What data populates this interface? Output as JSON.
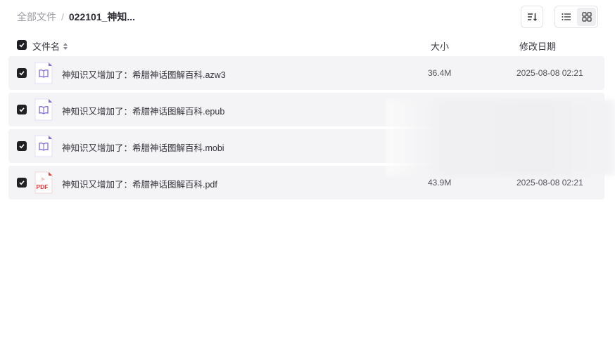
{
  "breadcrumb": {
    "root": "全部文件",
    "separator": "/",
    "current": "022101_神知..."
  },
  "toolbar": {
    "sort_icon": "sort-icon",
    "list_view_icon": "list-view-icon",
    "grid_view_icon": "grid-view-icon"
  },
  "table": {
    "columns": {
      "name": "文件名",
      "size": "大小",
      "date": "修改日期"
    },
    "rows": [
      {
        "name": "神知识又增加了：希腊神话图解百科.azw3",
        "size": "36.4M",
        "date": "2025-08-08 02:21",
        "type": "ebook",
        "checked": true
      },
      {
        "name": "神知识又增加了：希腊神话图解百科.epub",
        "size": "",
        "date": "",
        "type": "ebook",
        "checked": true
      },
      {
        "name": "神知识又增加了：希腊神话图解百科.mobi",
        "size": "",
        "date": "",
        "type": "ebook",
        "checked": true
      },
      {
        "name": "神知识又增加了：希腊神话图解百科.pdf",
        "size": "43.9M",
        "date": "2025-08-08 02:21",
        "type": "pdf",
        "checked": true
      }
    ]
  },
  "pdf_icon_label": "PDF",
  "colors": {
    "row_bg": "#f4f4f6",
    "ebook_icon": "#7c6ce0",
    "pdf_icon": "#e23b3b",
    "checkbox": "#1f1f24"
  }
}
